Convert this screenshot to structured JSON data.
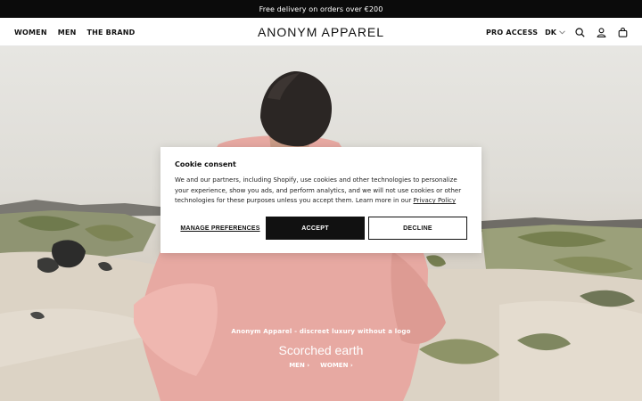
{
  "announcement": "Free delivery on orders over €200",
  "header": {
    "nav_left": [
      "WOMEN",
      "MEN",
      "THE BRAND"
    ],
    "logo": "ANONYM APPAREL",
    "pro_access": "PRO ACCESS",
    "language": "DK",
    "icons": [
      "search-icon",
      "account-icon",
      "cart-icon"
    ]
  },
  "hero": {
    "tagline": "Anonym Apparel - discreet luxury without a logo",
    "headline": "Scorched earth",
    "links": [
      {
        "label": "MEN",
        "arrow": "›"
      },
      {
        "label": "WOMEN",
        "arrow": "›"
      }
    ]
  },
  "cookie": {
    "title": "Cookie consent",
    "body": "We and our partners, including Shopify, use cookies and other technologies to personalize your experience, show you ads, and perform analytics, and we will not use cookies or other technologies for these purposes unless you accept them. Learn more in our ",
    "policy_link": "Privacy Policy",
    "manage_label": "MANAGE PREFERENCES",
    "accept_label": "ACCEPT",
    "decline_label": "DECLINE"
  },
  "colors": {
    "announcement_bg": "#0b0b0b",
    "button_dark": "#111111",
    "shirt_pink": "#e7a9a2"
  }
}
